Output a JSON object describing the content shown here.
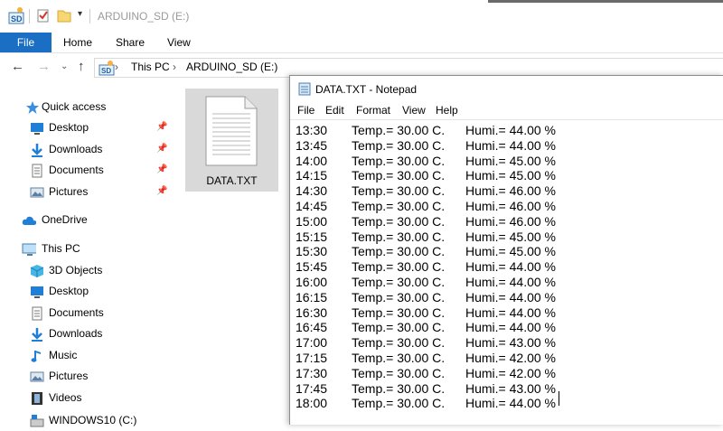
{
  "explorer": {
    "window_title": "ARDUINO_SD (E:)",
    "ribbon_tabs": [
      "File",
      "Home",
      "Share",
      "View"
    ],
    "breadcrumb": [
      "This PC",
      "ARDUINO_SD (E:)"
    ],
    "quick_access": {
      "header": "Quick access",
      "items": [
        "Desktop",
        "Downloads",
        "Documents",
        "Pictures"
      ]
    },
    "onedrive": "OneDrive",
    "this_pc": {
      "header": "This PC",
      "items": [
        "3D Objects",
        "Desktop",
        "Documents",
        "Downloads",
        "Music",
        "Pictures",
        "Videos",
        "WINDOWS10 (C:)"
      ]
    },
    "file": {
      "name": "DATA.TXT"
    }
  },
  "notepad": {
    "title": "DATA.TXT - Notepad",
    "menu": [
      "File",
      "Edit",
      "Format",
      "View",
      "Help"
    ],
    "lines": [
      {
        "time": "13:30",
        "temp": "Temp.= 30.00 C.",
        "humi": "Humi.= 44.00 %"
      },
      {
        "time": "13:45",
        "temp": "Temp.= 30.00 C.",
        "humi": "Humi.= 44.00 %"
      },
      {
        "time": "14:00",
        "temp": "Temp.= 30.00 C.",
        "humi": "Humi.= 45.00 %"
      },
      {
        "time": "14:15",
        "temp": "Temp.= 30.00 C.",
        "humi": "Humi.= 45.00 %"
      },
      {
        "time": "14:30",
        "temp": "Temp.= 30.00 C.",
        "humi": "Humi.= 46.00 %"
      },
      {
        "time": "14:45",
        "temp": "Temp.= 30.00 C.",
        "humi": "Humi.= 46.00 %"
      },
      {
        "time": "15:00",
        "temp": "Temp.= 30.00 C.",
        "humi": "Humi.= 46.00 %"
      },
      {
        "time": "15:15",
        "temp": "Temp.= 30.00 C.",
        "humi": "Humi.= 45.00 %"
      },
      {
        "time": "15:30",
        "temp": "Temp.= 30.00 C.",
        "humi": "Humi.= 45.00 %"
      },
      {
        "time": "15:45",
        "temp": "Temp.= 30.00 C.",
        "humi": "Humi.= 44.00 %"
      },
      {
        "time": "16:00",
        "temp": "Temp.= 30.00 C.",
        "humi": "Humi.= 44.00 %"
      },
      {
        "time": "16:15",
        "temp": "Temp.= 30.00 C.",
        "humi": "Humi.= 44.00 %"
      },
      {
        "time": "16:30",
        "temp": "Temp.= 30.00 C.",
        "humi": "Humi.= 44.00 %"
      },
      {
        "time": "16:45",
        "temp": "Temp.= 30.00 C.",
        "humi": "Humi.= 44.00 %"
      },
      {
        "time": "17:00",
        "temp": "Temp.= 30.00 C.",
        "humi": "Humi.= 43.00 %"
      },
      {
        "time": "17:15",
        "temp": "Temp.= 30.00 C.",
        "humi": "Humi.= 42.00 %"
      },
      {
        "time": "17:30",
        "temp": "Temp.= 30.00 C.",
        "humi": "Humi.= 42.00 %"
      },
      {
        "time": "17:45",
        "temp": "Temp.= 30.00 C.",
        "humi": "Humi.= 43.00 %"
      },
      {
        "time": "18:00",
        "temp": "Temp.= 30.00 C.",
        "humi": "Humi.= 44.00 %"
      }
    ]
  },
  "colors": {
    "accent": "#1a6fc4",
    "selection": "#d9d9d9"
  }
}
